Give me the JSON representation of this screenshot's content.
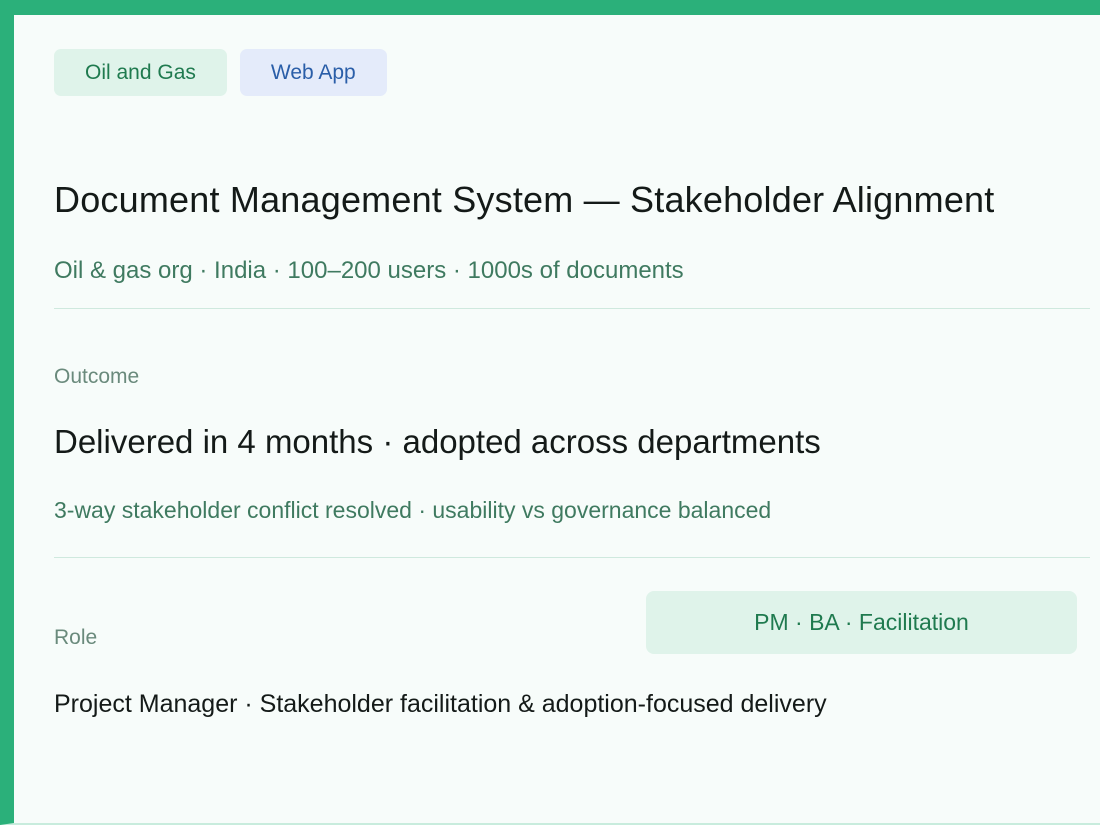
{
  "tags": {
    "industry": "Oil and Gas",
    "type": "Web App"
  },
  "project": {
    "title": "Document Management System — Stakeholder Alignment",
    "subtitle": "Oil & gas org · India · 100–200 users · 1000s of documents"
  },
  "outcome": {
    "label": "Outcome",
    "headline": "Delivered in 4 months · adopted across departments",
    "detail": "3-way stakeholder conflict resolved · usability vs governance balanced"
  },
  "role": {
    "label": "Role",
    "badge": "PM · BA · Facilitation",
    "detail": "Project Manager · Stakeholder facilitation & adoption-focused delivery"
  },
  "colors": {
    "accent": "#2bb07a",
    "industry_tag_bg": "#dff3ea",
    "type_tag_bg": "#e4ebfa",
    "muted_text": "#3f7a60"
  }
}
